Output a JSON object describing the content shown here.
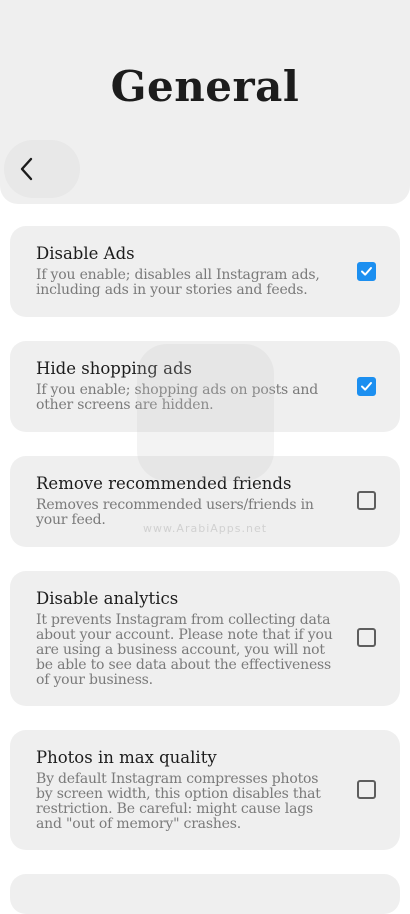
{
  "header": {
    "title": "General",
    "back_icon": "chevron-left-icon"
  },
  "settings": [
    {
      "title": "Disable Ads",
      "description": "If you enable; disables all Instagram ads, including ads in your stories and feeds.",
      "checked": true
    },
    {
      "title": "Hide shopping ads",
      "description": "If you enable; shopping ads on posts and other screens are hidden.",
      "checked": true
    },
    {
      "title": "Remove recommended friends",
      "description": "Removes recommended users/friends in your feed.",
      "checked": false
    },
    {
      "title": "Disable analytics",
      "description": "It prevents Instagram from collecting data about your account. Please note that if you are using a business account, you will not be able to see data about the effectiveness of your business.",
      "checked": false
    },
    {
      "title": "Photos in max quality",
      "description": "By default Instagram compresses photos by screen width, this option disables that restriction. Be careful: might cause lags and \"out of memory\" crashes.",
      "checked": false
    }
  ],
  "watermark": {
    "text": "www.ArabiApps.net"
  },
  "colors": {
    "accent": "#1c8ff0",
    "card_background": "#efefef",
    "header_background": "#efefef",
    "description_text": "#7a7a7a"
  }
}
